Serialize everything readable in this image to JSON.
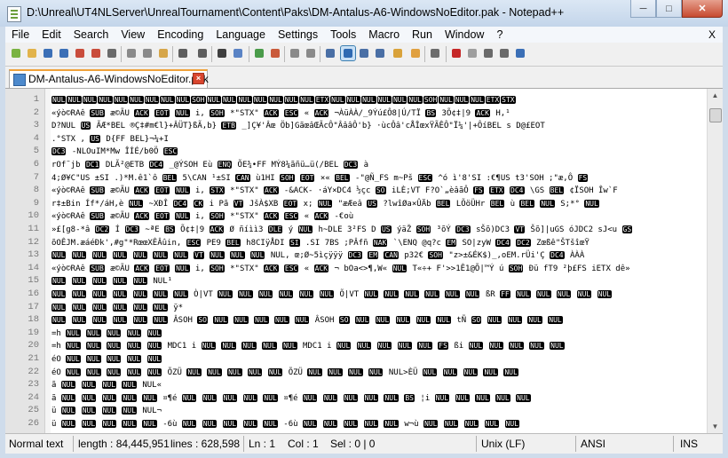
{
  "window": {
    "title": "D:\\Unreal\\UT4NLServer\\UnrealTournament\\Content\\Paks\\DM-Antalus-A6-WindowsNoEditor.pak - Notepad++",
    "buttons": [
      "minimize-icon",
      "maximize-icon",
      "close-icon"
    ]
  },
  "menu": {
    "items": [
      "File",
      "Edit",
      "Search",
      "View",
      "Encoding",
      "Language",
      "Settings",
      "Tools",
      "Macro",
      "Run",
      "Window",
      "?"
    ],
    "close_label": "X"
  },
  "toolbar": {
    "icons": [
      "new-file-icon",
      "open-file-icon",
      "save-icon",
      "save-all-icon",
      "close-file-icon",
      "close-all-icon",
      "print-icon",
      "cut-icon",
      "copy-icon",
      "paste-icon",
      "undo-icon",
      "redo-icon",
      "find-icon",
      "replace-icon",
      "zoom-in-icon",
      "zoom-out-icon",
      "sync-vertical-icon",
      "sync-horizontal-icon",
      "word-wrap-icon",
      "show-all-characters-icon",
      "indent-guide-icon",
      "document-map-icon",
      "function-list-icon",
      "folder-as-workspace-icon",
      "monitoring-icon",
      "record-macro-icon",
      "stop-macro-icon",
      "play-macro-icon",
      "run-macro-multiple-icon",
      "save-macro-icon"
    ],
    "active_icon": "show-all-characters-icon"
  },
  "tab": {
    "label": "DM-Antalus-A6-WindowsNoEditor.pak"
  },
  "editor": {
    "line_numbers": [
      "1",
      "2",
      "3",
      "4",
      "5",
      "6",
      "7",
      "8",
      "9",
      "10",
      "11",
      "12",
      "13",
      "14",
      "15",
      "16",
      "17",
      "18",
      "19",
      "20",
      "21",
      "22",
      "23",
      "24",
      "25",
      "26"
    ],
    "lines": [
      [
        "NUL",
        "NUL",
        "NUL",
        "NUL",
        "NUL",
        "NUL",
        "NUL",
        "NUL",
        "NUL",
        "SOH",
        "NUL",
        "NUL",
        "NUL",
        "NUL",
        "NUL",
        "NUL",
        "NUL",
        "ETX",
        "NUL",
        "NUL",
        "NUL",
        "NUL",
        "NUL",
        "NUL",
        "SOH",
        "NUL",
        "NUL",
        "NUL",
        "ETX",
        "STX"
      ],
      "«ýò©RAê SUB æ©ÃU ACK EOT NUL i, SOH *\"STX\" ACK ESC « ACK ¬ÀüÀÀ/_9Ýú£Ô8|Ú/TÏ BS 3Õ¢‡|9 ACK H,¹",
      "D?NUL US ÃÆ*BEL ®Ç‡#m€l}+ÂÜT}ßÃ,b} ETB _]Ç¥'Âœ Öb]GãœâŒÃcÔ\"ÂââÔ'b} ·ùcÔâ'cÅÎœxŸÃÊÔ\"Ï¼'|+ÔíBEL s D@£EOT",
      ".°STX , US D{FF BEL}¬¼+I",
      "DC3 -NLOuIM*Mw ÎÍÉ/b0Ö ESC",
      "rOf¨jb DC1 DLÃ²@ETB DC4 _@ÝSOH Eù ENQ ÕE¾•FF MÝ8¼ãñü…ü(/BEL DC3 à",
      "4;Ø¥C\"US ±SI .)*M.ê1`ô BEL 5\\CAN ¹±SI CAN ù1HI SOH EOT ×« BEL -\"@Ñ_FS m~Pš ESC ^ó ì'8'SI :€¶US t3'SOH ;\"æ,Ô FS",
      "«ýò©RAê SUB æ©ÃU ACK EOT NUL i, STX *\"STX\" ACK -&ACK- ·áY×DC4 ½çc SO iLÈ;VT F?O`„èâãÔ FS ETX DC4 \\GS BEL ¢ÏSOH Îw`F",
      "r‡±Bin Íf*/áH,è NUL ~XÐÎ DC4 CK i Pã VT JšÀ$XB EOT x; NUL \"æÆeâ US ?lwîØa×ÛÄb BEL LÕöÜHr BEL ù BEL NUL S;*° NUL",
      "«ýò©RAê SUB æ©ÃU ACK EOT NUL i, SOH *\"STX\" ACK ESC « ACK -€où",
      "»£[g8-*â DC2 Í DC3 ~ªE BS Õ¢‡|9 ACK Ø ñíìì3 DLE ý NUL h~DLE 3²FS D US ýäŽ SOH ³õÝ DC3 sŠõ)DC3 VT Šõ]|uGS óJDC2 sJ<u GS",
      "õOÊJM.æáéÐk',#g\"*RœœXÊÂûin, ESC PE9 BEL h8CIÿÅDI SI .SI 7BS ;PÂfñ NAK `\\ENQ @q?c EM SO|zyW DC4 DC2 Zœßê\"ŠTšîœŸ",
      "NUL NUL NUL NUL NUL NUL NUL VT NUL NUL NUL NUL, œ;Ø~5ìçÿÿÿ DC3 EM CAN p32€ SOH \"z>±&ÉK$)_,oEM.rÜi'Ç DC4 ÀÀÀ",
      "«ýò©RAê SUB æ©ÃU ACK EOT NUL i, SOH *\"STX\" ACK ESC « ACK ¬ bOa<>¶,W« NUL T«÷+ F'>>1Ê1@Õ|™Ý ú SOH Ðü fT9 ²þ£FS iETX dê»",
      "NUL NUL NUL NUL NUL NUL¹",
      "NUL NUL NUL NUL NUL NUL NUL Ò|VT NUL NUL NUL NUL NUL NUL Õ|VT NUL NUL NUL NUL NUL NUL ßR FF NUL NUL NUL NUL NUL",
      "NUL NUL NUL NUL NUL NUL ÿ*",
      "NUL NUL NUL NUL NUL NUL ÂSOH SO NUL NUL NUL NUL NUL ÂSOH SO NUL NUL NUL NUL NUL tÑ SO NUL NUL NUL NUL",
      "=h NUL NUL NUL NUL NUL",
      "=h NUL NUL NUL NUL NUL MDC1 i NUL NUL NUL NUL NUL MDC1 i NUL NUL NUL NUL NUL FS ßi NUL NUL NUL NUL NUL",
      "éO NUL NUL NUL NUL NUL",
      "éO NUL NUL NUL NUL NUL ÕZÜ NUL NUL NUL NUL NUL ÕZÜ NUL NUL NUL NUL NUL>ÈÜ NUL NUL NUL NUL NUL",
      "ã NUL NUL NUL NUL NUL«",
      "ã NUL NUL NUL NUL NUL ¤¶é NUL NUL NUL NUL NUL ¤¶é NUL NUL NUL NUL NUL BS ¦i NUL NUL NUL NUL NUL",
      "ü NUL NUL NUL NUL NUL¬",
      "ü NUL NUL NUL NUL NUL -6ù NUL NUL NUL NUL NUL -6ù NUL NUL NUL NUL NUL w¬ù NUL NUL NUL NUL NUL"
    ]
  },
  "status": {
    "doc_type": "Normal text",
    "length": "length : 84,445,951",
    "lines": "lines : 628,598",
    "ln": "Ln : 1",
    "col": "Col : 1",
    "sel": "Sel : 0 | 0",
    "eol": "Unix (LF)",
    "encoding": "ANSI",
    "mode": "INS"
  }
}
